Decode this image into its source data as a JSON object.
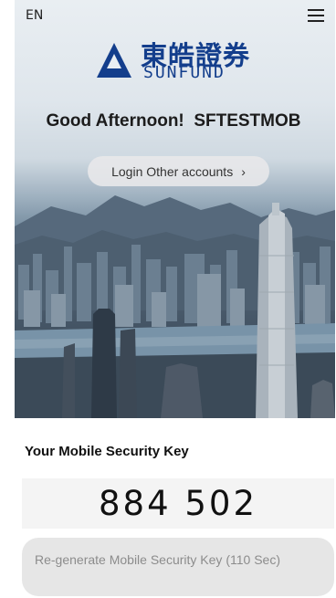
{
  "header": {
    "language_label": "EN"
  },
  "brand": {
    "name_cn": "東皓證券",
    "name_en": "SUNFUND"
  },
  "greeting": {
    "text": "Good Afternoon!",
    "username": "SFTESTMOB"
  },
  "login_other": {
    "label": "Login Other accounts",
    "chevron": "›"
  },
  "security_key": {
    "title": "Your Mobile Security Key",
    "code": "884 502",
    "regenerate_label": "Re-generate Mobile Security Key (110 Sec)"
  },
  "colors": {
    "brand_blue": "#133e8c",
    "button_gray": "#e6e6e6",
    "code_box_gray": "#f4f4f4"
  }
}
